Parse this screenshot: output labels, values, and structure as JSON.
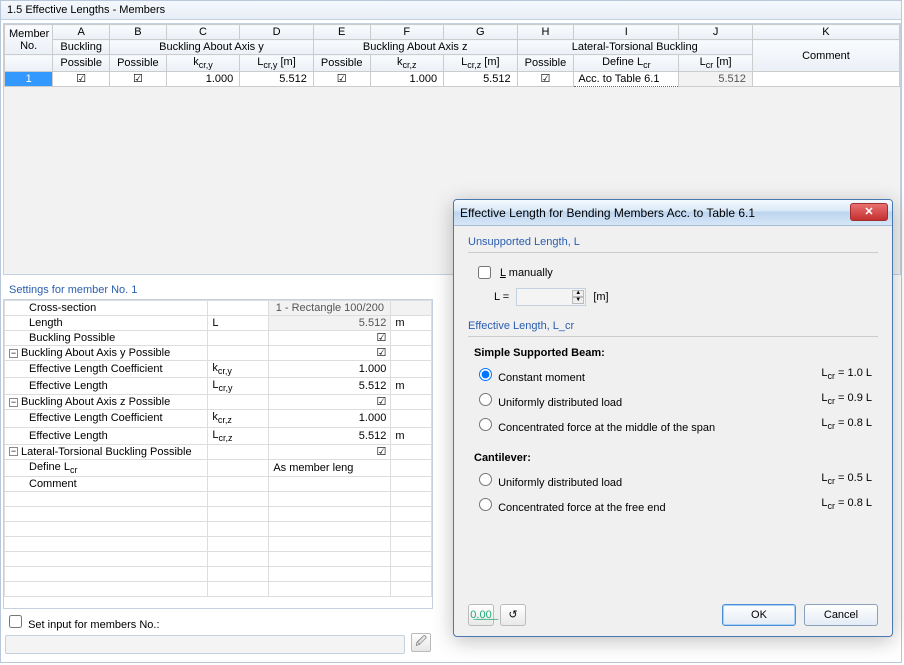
{
  "title": "1.5 Effective Lengths - Members",
  "columns_letters": [
    "A",
    "B",
    "C",
    "D",
    "E",
    "F",
    "G",
    "H",
    "I",
    "J",
    "K"
  ],
  "header_group1": {
    "memberNo": "Member\nNo.",
    "buckling": "Buckling",
    "axisy": "Buckling About Axis y",
    "axisz": "Buckling About Axis z",
    "ltb": "Lateral-Torsional Buckling",
    "comment": ""
  },
  "header_row2": {
    "possibleA": "Possible",
    "possibleB": "Possible",
    "kcry": "k cr,y",
    "Lcry": "L cr,y [m]",
    "possibleE": "Possible",
    "kcrz": "k cr,z",
    "Lcrz": "L cr,z [m]",
    "possibleH": "Possible",
    "defineLcr": "Define L cr",
    "Lcr": "L cr [m]",
    "comment": "Comment"
  },
  "row1": {
    "no": "1",
    "A": true,
    "B": true,
    "C": "1.000",
    "D": "5.512",
    "E": true,
    "F": "1.000",
    "G": "5.512",
    "H": true,
    "I": "Acc. to Table 6.1",
    "J": "5.512",
    "K": ""
  },
  "settingsTitle": "Settings for member No. 1",
  "settings": {
    "cross_section_label": "Cross-section",
    "cross_section_value": "1 - Rectangle 100/200",
    "length_label": "Length",
    "length_sym": "L",
    "length_val": "5.512",
    "length_unit": "m",
    "buckling_possible_label": "Buckling Possible",
    "buckling_possible_chk": true,
    "axisy_label": "Buckling About Axis y Possible",
    "axisy_chk": true,
    "elc_label": "Effective Length Coefficient",
    "el_label": "Effective Length",
    "kcry_sym": "k cr,y",
    "kcry_val": "1.000",
    "Lcry_sym": "L cr,y",
    "Lcry_val": "5.512",
    "Lcry_unit": "m",
    "axisz_label": "Buckling About Axis z Possible",
    "axisz_chk": true,
    "kcrz_sym": "k cr,z",
    "kcrz_val": "1.000",
    "Lcrz_sym": "L cr,z",
    "Lcrz_val": "5.512",
    "Lcrz_unit": "m",
    "ltb_label": "Lateral-Torsional Buckling Possible",
    "ltb_chk": true,
    "defineLcr_label": "Define L cr",
    "defineLcr_value": "As member leng",
    "comment_label": "Comment"
  },
  "bottomCheckbox": "Set input for members No.:",
  "dialog": {
    "title": "Effective Length for Bending Members Acc. to Table 6.1",
    "group1_title": "Unsupported Length, L",
    "Lmanual_label": "L manually",
    "Lmanual_chk": false,
    "Leq": "L =",
    "Lunit": "[m]",
    "group2_title": "Effective Length, L_cr",
    "sub1": "Simple Supported Beam:",
    "opts1": [
      {
        "label": "Constant moment",
        "rhs": "L cr = 1.0 L",
        "sel": true
      },
      {
        "label": "Uniformly distributed load",
        "rhs": "L cr = 0.9 L",
        "sel": false
      },
      {
        "label": "Concentrated force at the middle of the span",
        "rhs": "L cr = 0.8 L",
        "sel": false
      }
    ],
    "sub2": "Cantilever:",
    "opts2": [
      {
        "label": "Uniformly distributed load",
        "rhs": "L cr = 0.5 L",
        "sel": false
      },
      {
        "label": "Concentrated force at the free end",
        "rhs": "L cr = 0.8 L",
        "sel": false
      }
    ],
    "ok": "OK",
    "cancel": "Cancel"
  }
}
